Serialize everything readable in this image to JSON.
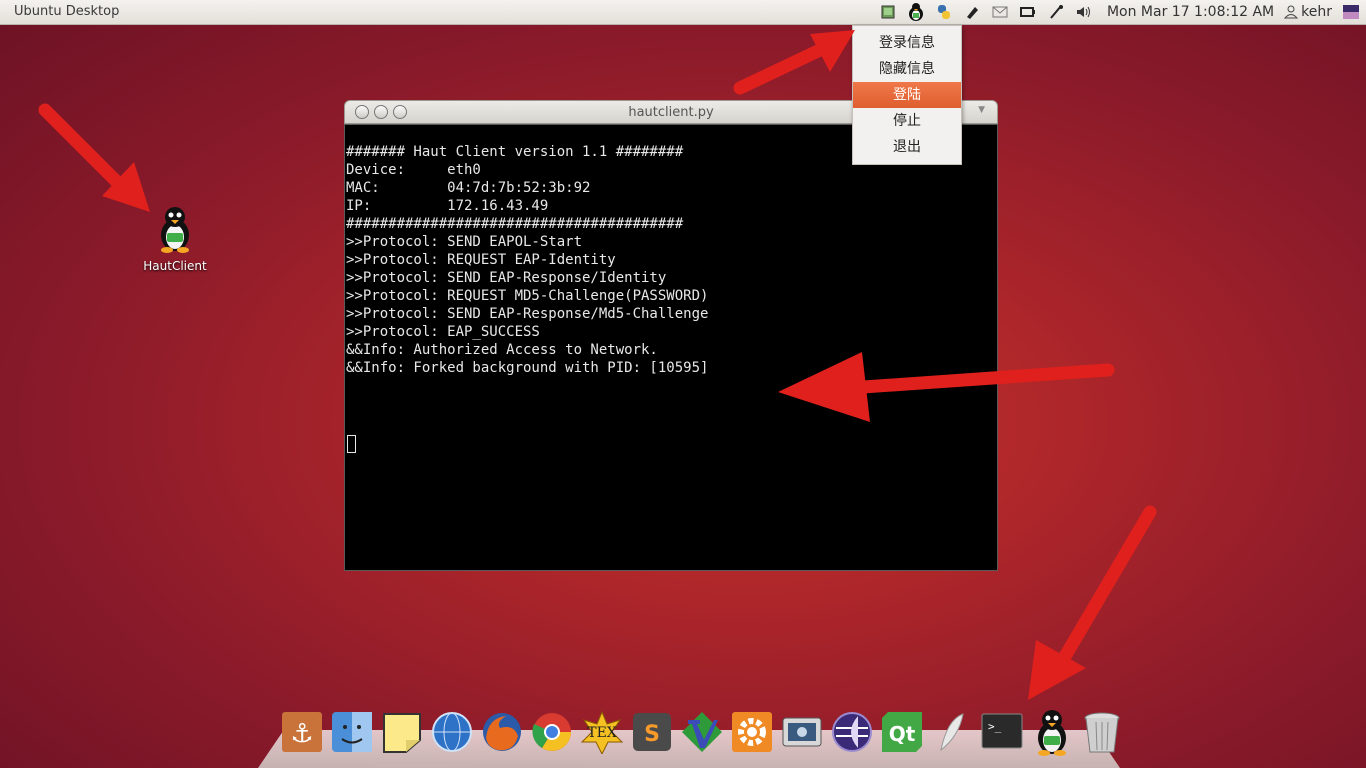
{
  "top_panel": {
    "title": "Ubuntu Desktop",
    "clock": "Mon Mar 17  1:08:12 AM",
    "user": "kehr",
    "tray_icons": [
      "system-monitor-icon",
      "hautclient-tray-icon",
      "python-icon",
      "usb-drive-icon",
      "mail-icon",
      "battery-icon",
      "bluetooth-icon",
      "volume-icon",
      "user-icon",
      "session-menu-icon"
    ]
  },
  "tray_menu": {
    "items": [
      "登录信息",
      "隐藏信息",
      "登陆",
      "停止",
      "退出"
    ],
    "active_index": 2
  },
  "desktop": {
    "icon_label": "HautClient"
  },
  "terminal": {
    "title": "hautclient.py",
    "lines": [
      "####### Haut Client version 1.1 ########",
      "Device:     eth0",
      "MAC:        04:7d:7b:52:3b:92",
      "IP:         172.16.43.49",
      "########################################",
      ">>Protocol: SEND EAPOL-Start",
      ">>Protocol: REQUEST EAP-Identity",
      ">>Protocol: SEND EAP-Response/Identity",
      ">>Protocol: REQUEST MD5-Challenge(PASSWORD)",
      ">>Protocol: SEND EAP-Response/Md5-Challenge",
      ">>Protocol: EAP_SUCCESS",
      "&&Info: Authorized Access to Network.",
      "&&Info: Forked background with PID: [10595]"
    ]
  },
  "dock": {
    "apps": [
      "anchor-icon",
      "finder-icon",
      "sticky-notes-icon",
      "browser-globe-icon",
      "firefox-icon",
      "chrome-icon",
      "tex-icon",
      "sublime-text-icon",
      "vim-icon",
      "settings-gear-icon",
      "screenshot-icon",
      "eclipse-icon",
      "qt-creator-icon",
      "feather-icon",
      "terminal-icon",
      "hautclient-dock-icon",
      "trash-icon"
    ]
  },
  "colors": {
    "desktop_bg": "#a8242a",
    "menu_active": "#e8683a",
    "arrow": "#e0201c"
  }
}
